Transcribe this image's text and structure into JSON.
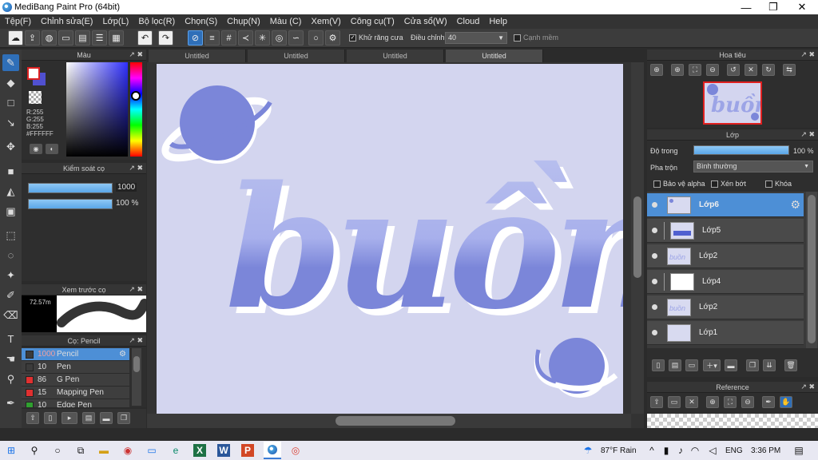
{
  "window": {
    "title": "MediBang Paint Pro (64bit)",
    "minimize": "—",
    "maximize": "❐",
    "close": "✕"
  },
  "menu": [
    "Tệp(F)",
    "Chỉnh sửa(E)",
    "Lớp(L)",
    "Bộ lọc(R)",
    "Chọn(S)",
    "Chụp(N)",
    "Màu (C)",
    "Xem(V)",
    "Công cụ(T)",
    "Cửa sổ(W)",
    "Cloud",
    "Help"
  ],
  "toolbar": {
    "antialias_label": "Khử răng cưa",
    "adjust_label": "Điều chỉnh",
    "adjust_value": "40",
    "smooth_label": "Cạnh mềm"
  },
  "color_panel": {
    "title": "Màu",
    "r": "R:255",
    "g": "G:255",
    "b": "B:255",
    "hex": "#FFFFFF"
  },
  "brush_control": {
    "title": "Kiểm soát cọ",
    "size_value": "1000",
    "opacity_value": "100 %"
  },
  "brush_preview": {
    "title": "Xem trước cọ",
    "size": "72.57m"
  },
  "brush_list": {
    "title": "Cọ: Pencil",
    "items": [
      {
        "size": "1000",
        "name": "Pencil",
        "color": "#3b3b3b"
      },
      {
        "size": "10",
        "name": "Pen",
        "color": "#3b3b3b"
      },
      {
        "size": "86",
        "name": "G Pen",
        "color": "#e03030"
      },
      {
        "size": "15",
        "name": "Mapping Pen",
        "color": "#e03030"
      },
      {
        "size": "10",
        "name": "Edge Pen",
        "color": "#30a030"
      }
    ]
  },
  "tabs": [
    "Untitled",
    "Untitled",
    "Untitled",
    "Untitled"
  ],
  "artwork": {
    "background": "#d3d5ef",
    "accent": "#7b86d9",
    "light": "#b9c0ee"
  },
  "navigator": {
    "title": "Hoa tiêu"
  },
  "layers": {
    "title": "Lớp",
    "opacity_label": "Độ trong",
    "opacity_value": "100 %",
    "blend_label": "Pha trộn",
    "blend_value": "Bình thường",
    "protect_alpha": "Bảo vệ alpha",
    "clipping": "Xén bớt",
    "lock": "Khóa",
    "items": [
      {
        "name": "Lớp6"
      },
      {
        "name": "Lớp5"
      },
      {
        "name": "Lớp2"
      },
      {
        "name": "Lớp4"
      },
      {
        "name": "Lớp2"
      },
      {
        "name": "Lớp1"
      }
    ]
  },
  "reference": {
    "title": "Reference"
  },
  "taskbar": {
    "weather": "87°F  Rain",
    "lang": "ENG",
    "time": "3:36 PM"
  }
}
